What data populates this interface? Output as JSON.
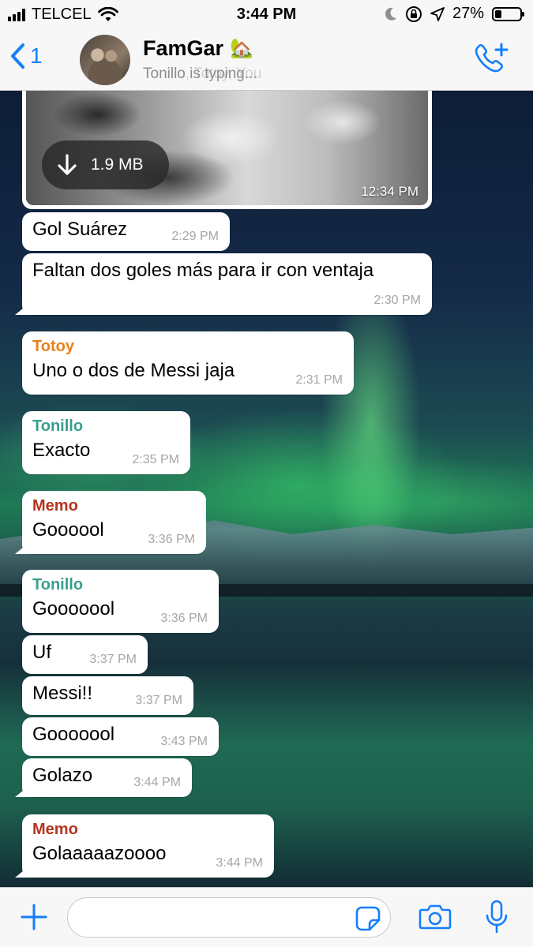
{
  "status_bar": {
    "carrier": "TELCEL",
    "time": "3:44 PM",
    "battery": "27%",
    "battery_level": 0.27
  },
  "header": {
    "back_count": "1",
    "title": "FamGar",
    "title_emoji": "🏡",
    "typing": "Tonillo is typing...",
    "participants": "Tonillo, Totoy, You",
    "call_icon": "phone-add-icon"
  },
  "media_message": {
    "size": "1.9 MB",
    "time": "12:34 PM"
  },
  "messages": [
    {
      "sender": "",
      "text": "Gol Suárez",
      "time": "2:29 PM"
    },
    {
      "sender": "",
      "text": "Faltan dos goles más para ir con ventaja",
      "time": "2:30 PM"
    },
    {
      "sender": "Totoy",
      "text": "Uno o dos de Messi jaja",
      "time": "2:31 PM"
    },
    {
      "sender": "Tonillo",
      "text": "Exacto",
      "time": "2:35 PM"
    },
    {
      "sender": "Memo",
      "text": "Goooool",
      "time": "3:36 PM"
    },
    {
      "sender": "Tonillo",
      "text": "Gooooool",
      "time": "3:36 PM"
    },
    {
      "sender": "",
      "text": "Uf",
      "time": "3:37 PM"
    },
    {
      "sender": "",
      "text": "Messi!!",
      "time": "3:37 PM"
    },
    {
      "sender": "",
      "text": "Gooooool",
      "time": "3:43 PM"
    },
    {
      "sender": "",
      "text": "Golazo",
      "time": "3:44 PM"
    },
    {
      "sender": "Memo",
      "text": "Golaaaaazoooo",
      "time": "3:44 PM"
    }
  ],
  "sender_colors": {
    "Totoy": "#e8801a",
    "Tonillo": "#3a9e8f",
    "Memo": "#b5341d"
  },
  "input": {
    "placeholder": "",
    "icons": [
      "plus-icon",
      "sticker-icon",
      "camera-icon",
      "microphone-icon"
    ]
  },
  "accent_color": "#147efb"
}
